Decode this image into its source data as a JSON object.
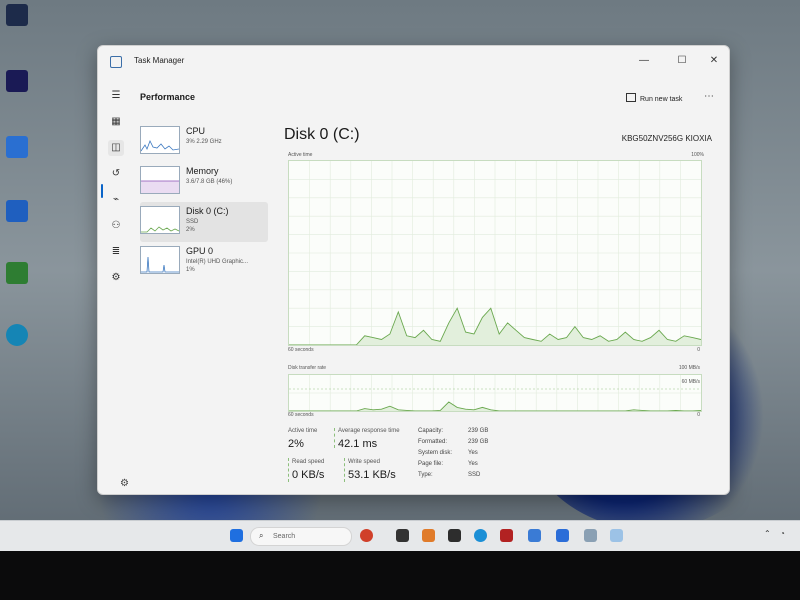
{
  "window": {
    "title": "Task Manager",
    "page_title": "Performance",
    "run_new_task_label": "Run new task",
    "more_icon": "⋯",
    "min_icon": "—",
    "max_icon": "☐",
    "close_icon": "✕"
  },
  "devices": [
    {
      "name": "CPU",
      "sub1": "3% 2.29 GHz",
      "sub2": ""
    },
    {
      "name": "Memory",
      "sub1": "3.6/7.8 GB (46%)",
      "sub2": ""
    },
    {
      "name": "Disk 0 (C:)",
      "sub1": "SSD",
      "sub2": "2%"
    },
    {
      "name": "GPU 0",
      "sub1": "Intel(R) UHD Graphic...",
      "sub2": "1%"
    }
  ],
  "disk": {
    "title": "Disk 0 (C:)",
    "model": "KBG50ZNV256G KIOXIA",
    "active_time_label": "Active time",
    "active_time_max": "100%",
    "time_span": "60 seconds",
    "zero": "0",
    "transfer_label": "Disk transfer rate",
    "transfer_max": "100 MB/s",
    "transfer_mid": "60 MB/s",
    "active_time_series": [
      0,
      0,
      0,
      0,
      0,
      0,
      0,
      0,
      0,
      5,
      4,
      3,
      6,
      18,
      5,
      4,
      8,
      3,
      2,
      12,
      20,
      7,
      6,
      15,
      20,
      6,
      12,
      8,
      4,
      3,
      2,
      6,
      3,
      4,
      10,
      4,
      3,
      5,
      2,
      3,
      7,
      3,
      2,
      4,
      8,
      3,
      2,
      5,
      4,
      3
    ],
    "transfer_series": [
      0,
      0,
      0,
      0,
      0,
      0,
      0,
      0,
      0,
      4,
      2,
      3,
      8,
      2,
      1,
      0,
      0,
      0,
      1,
      15,
      6,
      3,
      2,
      6,
      2,
      0,
      0,
      0,
      0,
      0,
      0,
      0,
      0,
      0,
      0,
      0,
      0,
      0,
      0,
      0,
      0,
      2,
      1,
      0,
      0,
      0,
      1,
      0,
      0,
      1
    ]
  },
  "stats": {
    "active_time": {
      "label": "Active time",
      "value": "2%"
    },
    "avg_response": {
      "label": "Average response time",
      "value": "42.1 ms"
    },
    "read_speed": {
      "label": "Read speed",
      "value": "0 KB/s"
    },
    "write_speed": {
      "label": "Write speed",
      "value": "53.1 KB/s"
    },
    "capacity": {
      "label": "Capacity:",
      "value": "239 GB"
    },
    "formatted": {
      "label": "Formatted:",
      "value": "239 GB"
    },
    "system_disk": {
      "label": "System disk:",
      "value": "Yes"
    },
    "page_file": {
      "label": "Page file:",
      "value": "Yes"
    },
    "type": {
      "label": "Type:",
      "value": "SSD"
    }
  },
  "taskbar": {
    "search_placeholder": "Search"
  },
  "colors": {
    "accent": "#0a64c8",
    "disk_green": "#6aa84f",
    "window_bg": "#f3f3f3"
  }
}
